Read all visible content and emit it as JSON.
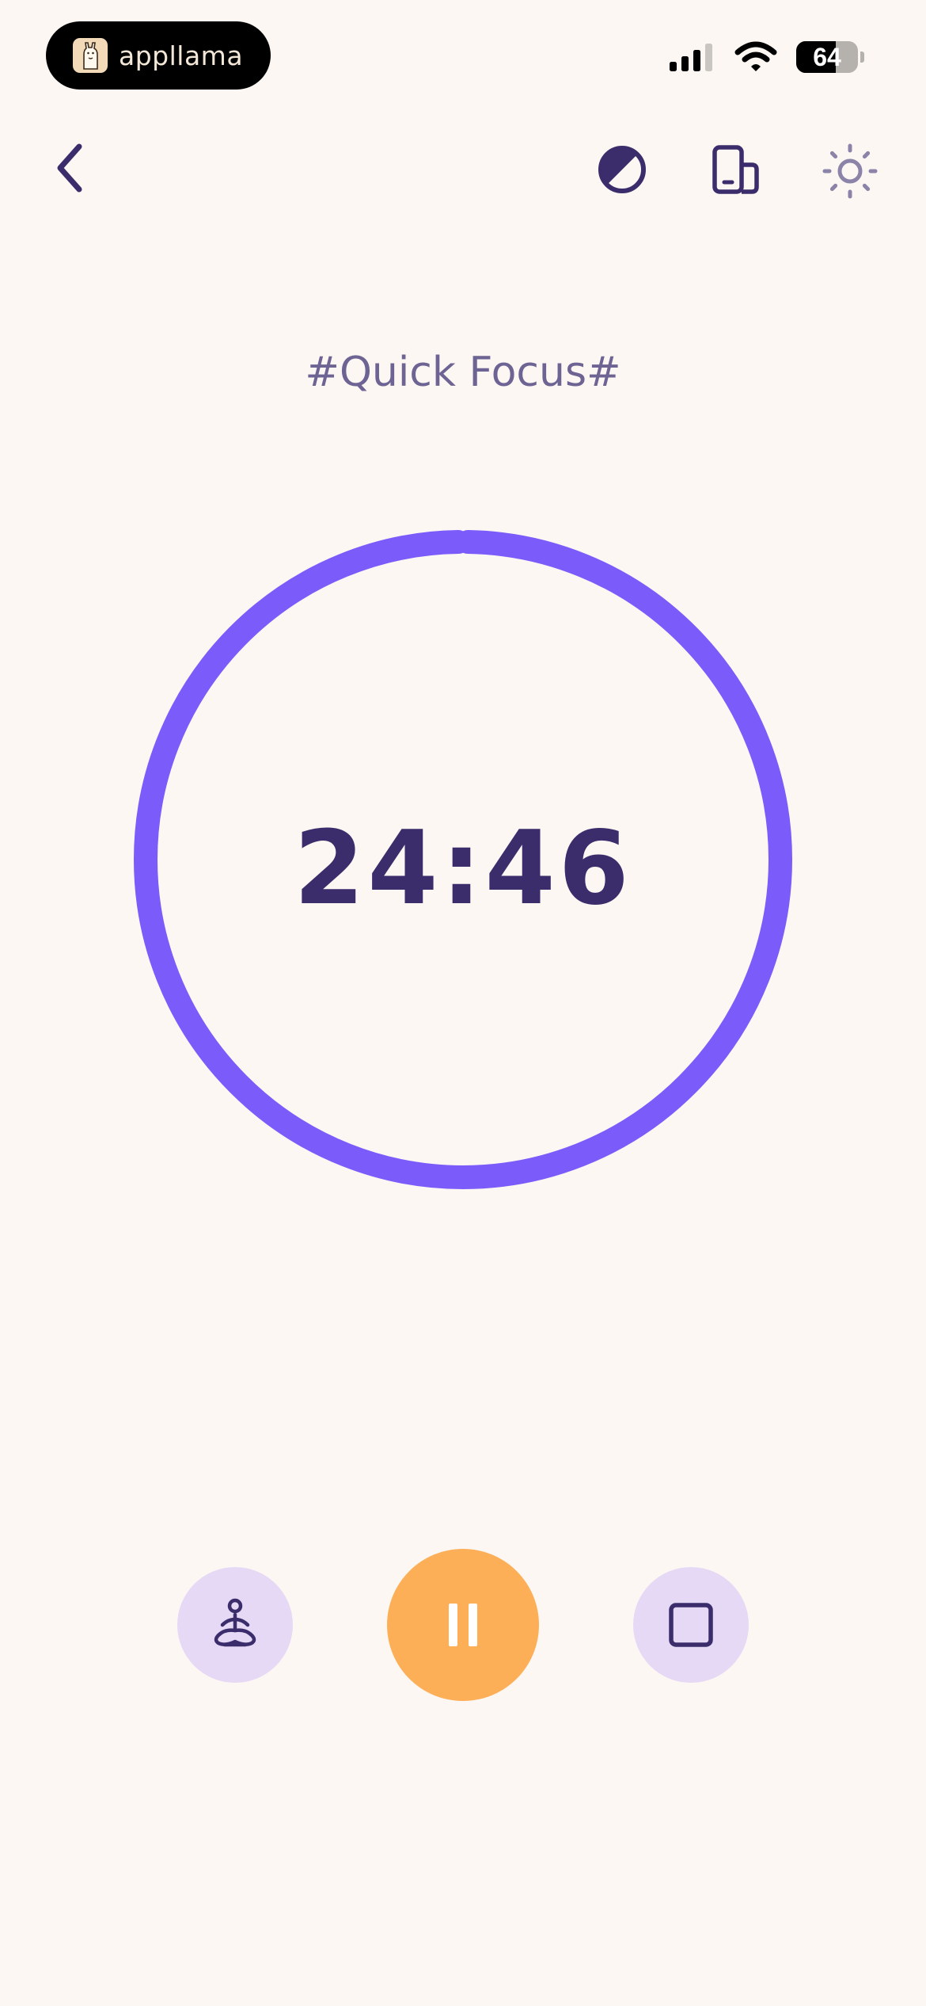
{
  "status_bar": {
    "app_name": "appllama",
    "battery_percent": "64",
    "battery_level": 0.64
  },
  "icons": {
    "back": "chevron-left-icon",
    "theme": "contrast-icon",
    "device": "device-rotate-icon",
    "brightness": "sun-icon",
    "meditate": "meditation-icon",
    "pause": "pause-icon",
    "stop": "stop-icon"
  },
  "session": {
    "title": "#Quick Focus#",
    "time_remaining": "24:46",
    "progress": 0.995
  },
  "colors": {
    "background": "#FCF7F3",
    "ring": "#7B5CFA",
    "primary_text": "#3B2D6B",
    "pause_button": "#FDAF58",
    "secondary_button": "#E5D9F5"
  }
}
